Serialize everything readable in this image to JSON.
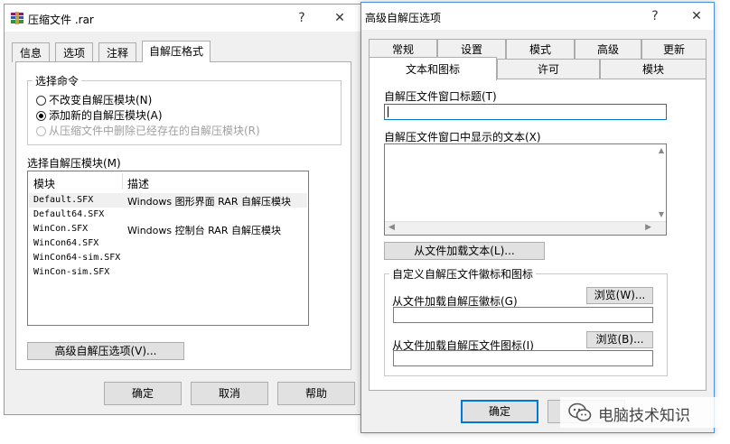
{
  "left_dialog": {
    "title": "压缩文件 .rar",
    "help_glyph": "?",
    "close_glyph": "✕",
    "tabs": [
      "信息",
      "选项",
      "注释",
      "自解压格式"
    ],
    "group_title": "选择命令",
    "radios": [
      {
        "label": "不改变自解压模块(N)",
        "checked": false,
        "disabled": false
      },
      {
        "label": "添加新的自解压模块(A)",
        "checked": true,
        "disabled": false
      },
      {
        "label": "从压缩文件中删除已经存在的自解压模块(R)",
        "checked": false,
        "disabled": true
      }
    ],
    "module_label": "选择自解压模块(M)",
    "columns": [
      "模块",
      "描述"
    ],
    "modules": [
      {
        "name": "Default.SFX",
        "desc": "Windows 图形界面 RAR 自解压模块"
      },
      {
        "name": "Default64.SFX",
        "desc": ""
      },
      {
        "name": "WinCon.SFX",
        "desc": "Windows 控制台 RAR 自解压模块"
      },
      {
        "name": "WinCon64.SFX",
        "desc": ""
      },
      {
        "name": "WinCon64-sim.SFX",
        "desc": ""
      },
      {
        "name": "WinCon-sim.SFX",
        "desc": ""
      }
    ],
    "advanced_button": "高级自解压选项(V)...",
    "ok": "确定",
    "cancel": "取消",
    "help": "帮助"
  },
  "right_dialog": {
    "title": "高级自解压选项",
    "help_glyph": "?",
    "close_glyph": "✕",
    "tabs_row1": [
      "常规",
      "设置",
      "模式",
      "高级",
      "更新"
    ],
    "tabs_row2": [
      "文本和图标",
      "许可",
      "模块"
    ],
    "window_title_label": "自解压文件窗口标题(T)",
    "window_title_value": "",
    "text_label": "自解压文件窗口中显示的文本(X)",
    "text_value": "",
    "load_text_button": "从文件加载文本(L)...",
    "icon_group_title": "自定义自解压文件徽标和图标",
    "logo_label": "从文件加载自解压徽标(G)",
    "browse_logo": "浏览(W)...",
    "icon_label": "从文件加载自解压文件图标(I)",
    "browse_icon": "浏览(B)...",
    "ok": "确定"
  },
  "watermark": "电脑技术知识"
}
